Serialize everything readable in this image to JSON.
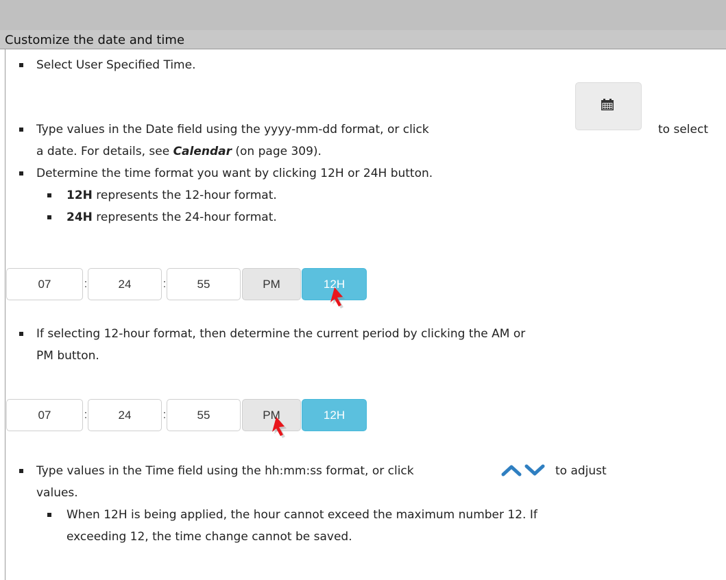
{
  "section": {
    "title": "Customize the date and time"
  },
  "steps": {
    "step1": "Select User Specified Time.",
    "step2_part1": "Type values in the Date field using the yyyy-mm-dd format, or click",
    "step2_part2": "to select",
    "step2_line2_part1": "a date. For details, see ",
    "step2_xref": "Calendar",
    "step2_line2_part2": " (on page 309).",
    "step3": "Determine the time format you want by clicking 12H or 24H button.",
    "sub12h_bold": "12H",
    "sub12h_rest": " represents the 12-hour format.",
    "sub24h_bold": "24H",
    "sub24h_rest": " represents the 24-hour format.",
    "step4_line1": "If selecting 12-hour format, then determine the current period by clicking the AM or",
    "step4_line2": "PM button.",
    "step5_part1": "Type values in the Time field using the hh:mm:ss format, or click",
    "step5_part2": "to adjust",
    "step5_line2": "values.",
    "note_line1": "When 12H is being applied, the hour cannot exceed the maximum number 12. If",
    "note_line2": "exceeding 12, the time change cannot be saved."
  },
  "time_widget_1": {
    "hour": "07",
    "sep1": ":",
    "minute": "24",
    "sep2": ":",
    "second": "55",
    "period": "PM",
    "format": "12H"
  },
  "time_widget_2": {
    "hour": "07",
    "sep1": ":",
    "minute": "24",
    "sep2": ":",
    "second": "55",
    "period": "PM",
    "format": "12H"
  },
  "icons": {
    "calendar": "calendar-icon",
    "up": "chevron-up-icon",
    "down": "chevron-down-icon",
    "cursor": "mouse-cursor-icon"
  },
  "colors": {
    "header_bg": "#c8c8c8",
    "accent_blue": "#5bc0de",
    "chevron_blue": "#2f7fc1",
    "cursor_red": "#e8151b"
  }
}
